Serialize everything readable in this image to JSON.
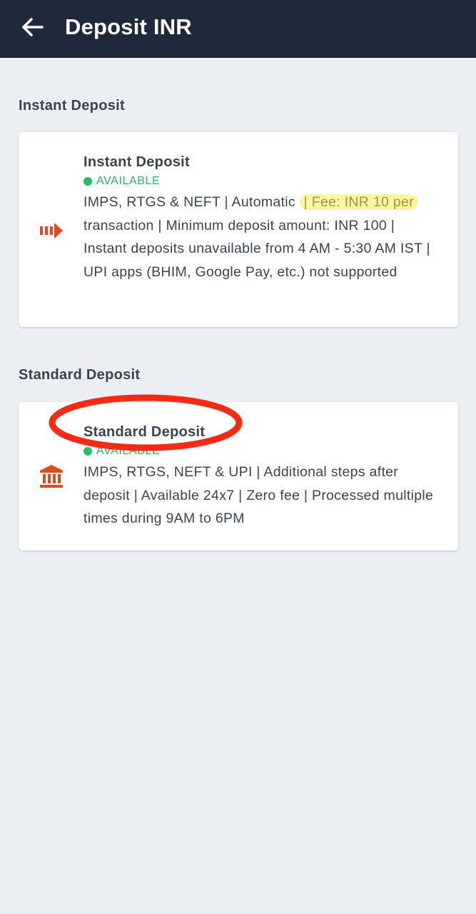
{
  "header": {
    "title": "Deposit INR",
    "back_icon": "arrow-left-icon"
  },
  "colors": {
    "header_bg": "#1e2a3a",
    "page_bg": "#ebeef2",
    "accent_orange": "#e0481f",
    "status_green": "#1ec15d",
    "highlight_yellow": "#fbf5a5",
    "annotation_red": "#f42a14"
  },
  "sections": [
    {
      "heading": "Instant Deposit",
      "card": {
        "icon": "fast-forward-arrow-icon",
        "title": "Instant Deposit",
        "status": "AVAILABLE",
        "desc_before": "IMPS, RTGS & NEFT | Automatic ",
        "desc_highlight": "| Fee: INR 10 per",
        "desc_after": " transaction | Minimum deposit amount: INR 100 | Instant deposits unavailable from 4 AM - 5:30 AM IST | UPI apps (BHIM, Google Pay, etc.) not supported"
      }
    },
    {
      "heading": "Standard Deposit",
      "card": {
        "icon": "bank-icon",
        "title": "Standard Deposit",
        "status": "AVAILABLE",
        "desc": "IMPS, RTGS, NEFT & UPI | Additional steps after deposit | Available 24x7 | Zero fee | Processed multiple times during 9AM to 6PM"
      }
    }
  ]
}
